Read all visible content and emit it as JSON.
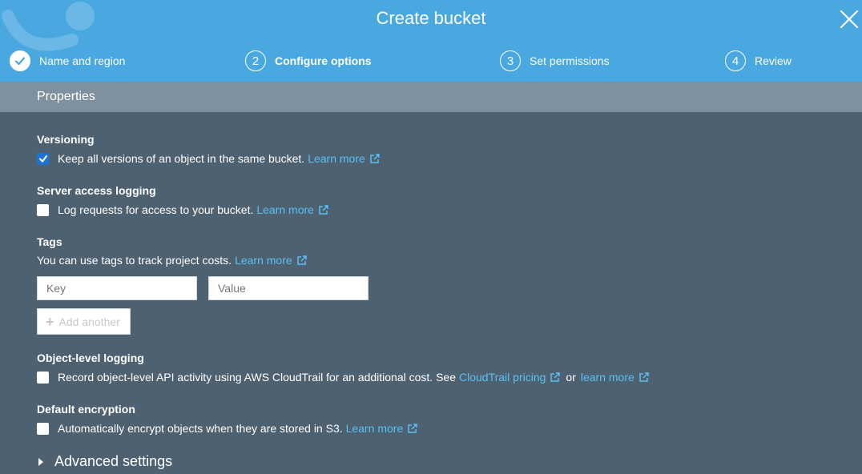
{
  "dialog": {
    "title": "Create bucket"
  },
  "steps": [
    {
      "num": "",
      "label": "Name and region",
      "state": "done"
    },
    {
      "num": "2",
      "label": "Configure options",
      "state": "active"
    },
    {
      "num": "3",
      "label": "Set permissions",
      "state": "pending"
    },
    {
      "num": "4",
      "label": "Review",
      "state": "pending"
    }
  ],
  "properties": {
    "heading": "Properties"
  },
  "versioning": {
    "title": "Versioning",
    "checked": true,
    "text": "Keep all versions of an object in the same bucket.",
    "link": "Learn more"
  },
  "server_logging": {
    "title": "Server access logging",
    "checked": false,
    "text": "Log requests for access to your bucket.",
    "link": "Learn more"
  },
  "tags": {
    "title": "Tags",
    "text": "You can use tags to track project costs.",
    "link": "Learn more",
    "key_placeholder": "Key",
    "value_placeholder": "Value",
    "add_label": "Add another"
  },
  "object_logging": {
    "title": "Object-level logging",
    "checked": false,
    "text": "Record object-level API activity using AWS CloudTrail for an additional cost. See",
    "link1": "CloudTrail pricing",
    "or": "or",
    "link2": "learn more"
  },
  "encryption": {
    "title": "Default encryption",
    "checked": false,
    "text": "Automatically encrypt objects when they are stored in S3.",
    "link": "Learn more"
  },
  "advanced": {
    "label": "Advanced settings"
  },
  "colors": {
    "header": "#4aa8e0",
    "bar": "#7f919e",
    "body": "#4d6171",
    "link": "#5bc0f5",
    "checkbox": "#1e73d6"
  }
}
